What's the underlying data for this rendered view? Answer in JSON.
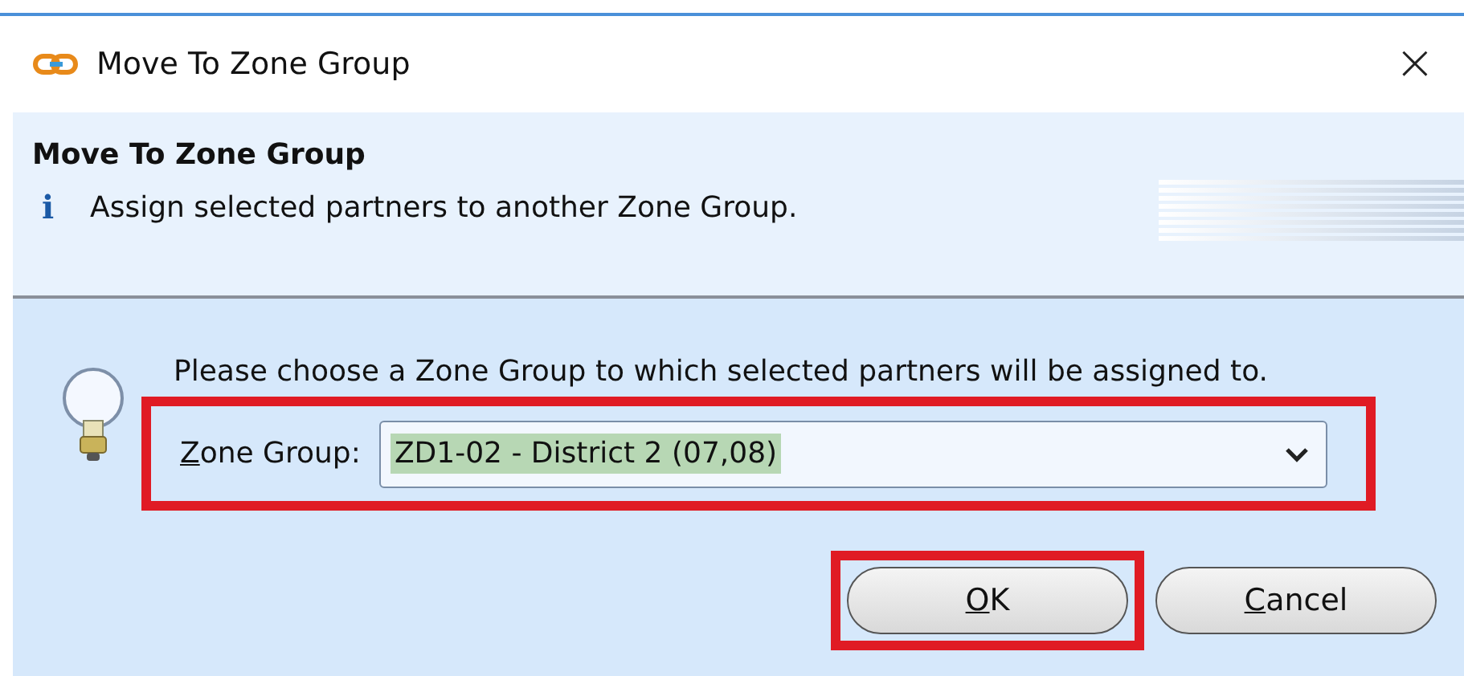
{
  "window": {
    "title": "Move To Zone Group",
    "close": "×"
  },
  "header": {
    "title": "Move To Zone Group",
    "info_icon": "i",
    "message": "Assign selected partners to another Zone Group."
  },
  "prompt": "Please choose a Zone Group to which selected partners will be assigned to.",
  "zone_group": {
    "label": "Zone Group:",
    "mnemonic": true,
    "value": "ZD1-02 - District 2 (07,08)",
    "value_selected": true,
    "annotated": true
  },
  "buttons": [
    {
      "label": "OK",
      "mnemonic": true,
      "annotated": true
    },
    {
      "label": "Cancel",
      "mnemonic": true,
      "annotated": false
    }
  ]
}
